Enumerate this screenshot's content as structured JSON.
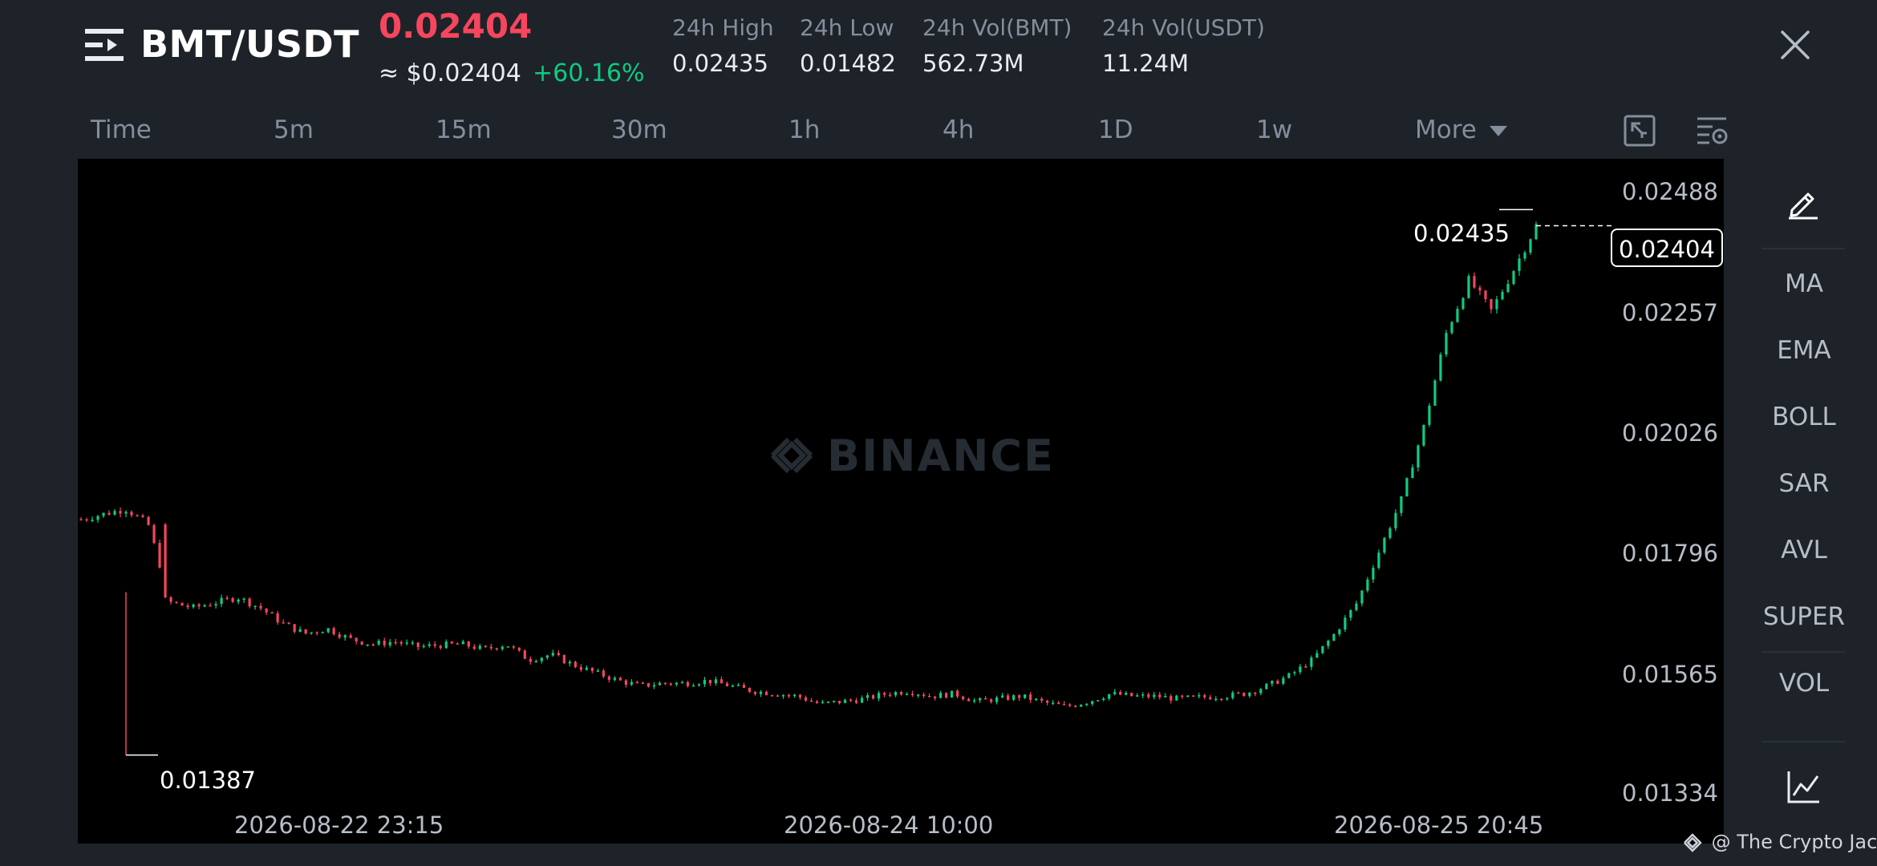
{
  "header": {
    "pair": "BMT/USDT",
    "price": "0.02404",
    "usd_price": "≈ $0.02404",
    "change": "+60.16%",
    "stats": [
      {
        "label": "24h High",
        "value": "0.02435"
      },
      {
        "label": "24h Low",
        "value": "0.01482"
      },
      {
        "label": "24h Vol(BMT)",
        "value": "562.73M"
      },
      {
        "label": "24h Vol(USDT)",
        "value": "11.24M"
      }
    ]
  },
  "timeframes": [
    "Time",
    "5m",
    "15m",
    "30m",
    "1h",
    "4h",
    "1D",
    "1w"
  ],
  "active_timeframe": "15m",
  "more_label": "More",
  "indicators": [
    "MA",
    "EMA",
    "BOLL",
    "SAR",
    "AVL",
    "SUPER",
    "VOL"
  ],
  "chart": {
    "watermark": "BINANCE",
    "y_ticks": [
      "0.02488",
      "0.02257",
      "0.02026",
      "0.01796",
      "0.01565",
      "0.01334"
    ],
    "x_ticks": [
      "2026-08-22 23:15",
      "2026-08-24 10:00",
      "2026-08-25 20:45"
    ],
    "current_price": "0.02404",
    "high_label": "0.02435",
    "low_label": "0.01387"
  },
  "chart_data": {
    "type": "candlestick",
    "ylim": [
      0.013,
      0.0252
    ],
    "y_ticks": [
      0.02488,
      0.02257,
      0.02026,
      0.01796,
      0.01565,
      0.01334
    ],
    "x_ticks": [
      "2026-08-22 23:15",
      "2026-08-24 10:00",
      "2026-08-25 20:45"
    ],
    "current_price": 0.02404,
    "high": 0.02435,
    "low": 0.01387,
    "close_path": [
      0.0184,
      0.0185,
      0.0186,
      0.0183,
      0.0168,
      0.0167,
      0.0168,
      0.0169,
      0.0167,
      0.0164,
      0.0162,
      0.0163,
      0.0161,
      0.016,
      0.01605,
      0.01595,
      0.01598,
      0.016,
      0.0159,
      0.016,
      0.0157,
      0.0158,
      0.0156,
      0.01545,
      0.0153,
      0.0152,
      0.01525,
      0.01525,
      0.0153,
      0.0152,
      0.0151,
      0.01505,
      0.015,
      0.01485,
      0.0149,
      0.01495,
      0.01505,
      0.0151,
      0.015,
      0.01505,
      0.0149,
      0.01495,
      0.015,
      0.01488,
      0.0148,
      0.0149,
      0.01505,
      0.015,
      0.015,
      0.01495,
      0.01498,
      0.015,
      0.01505,
      0.0152,
      0.0154,
      0.0157,
      0.0162,
      0.0168,
      0.0178,
      0.0188,
      0.0202,
      0.022,
      0.023,
      0.0224,
      0.0232,
      0.02404
    ]
  },
  "credit": "@ The Crypto Jack",
  "colors": {
    "up": "#0ecb81",
    "down": "#f6465d",
    "background": "#1e2329",
    "chart_background": "#000000",
    "muted": "#848e9c"
  },
  "icons": {
    "menu": "menu-icon",
    "close": "close-icon",
    "fullscreen": "fullscreen-exit-icon",
    "settings": "chart-settings-icon",
    "draw": "pencil-icon",
    "line": "line-chart-icon",
    "watermark": "binance-logo-icon"
  }
}
